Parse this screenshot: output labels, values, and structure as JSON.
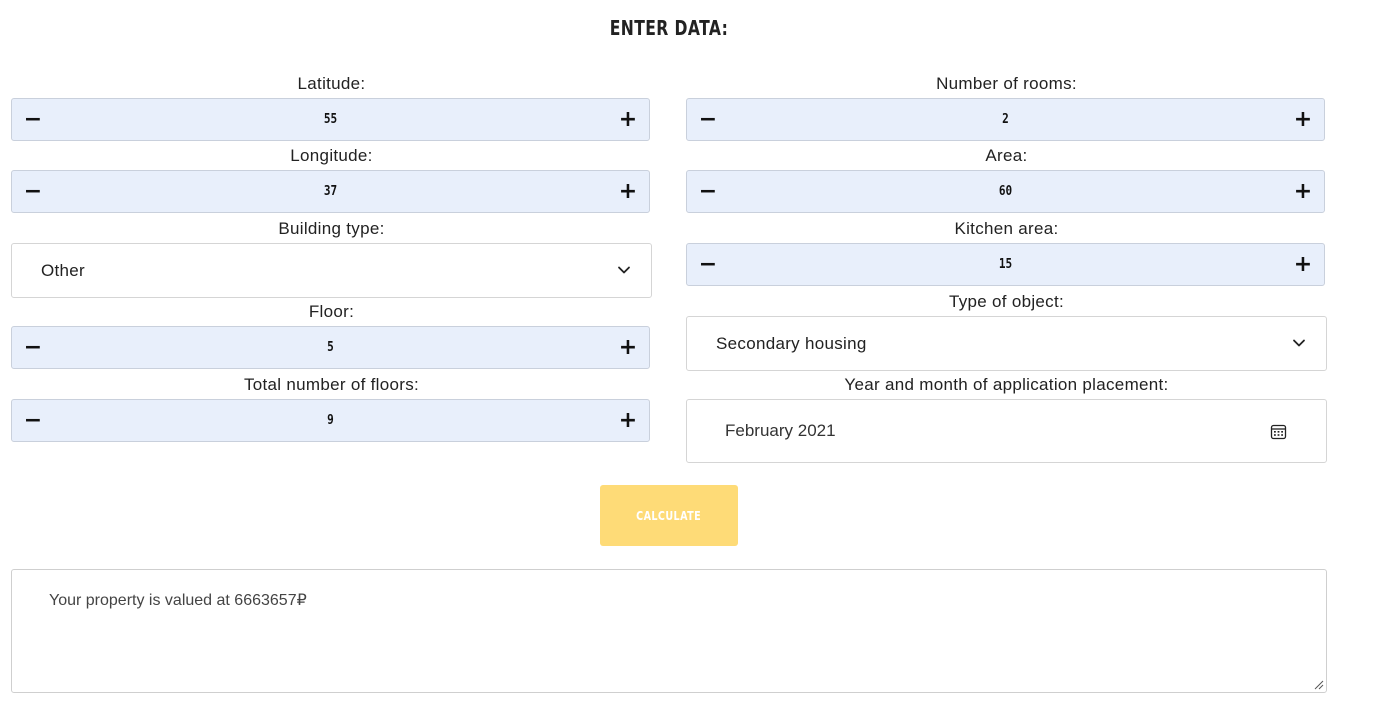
{
  "header": {
    "title": "ENTER DATA:"
  },
  "fields": {
    "latitude": {
      "label": "Latitude:",
      "value": "55",
      "minus": "−",
      "plus": "+"
    },
    "longitude": {
      "label": "Longitude:",
      "value": "37",
      "minus": "−",
      "plus": "+"
    },
    "building_type": {
      "label": "Building type:",
      "value": "Other"
    },
    "floor": {
      "label": "Floor:",
      "value": "5",
      "minus": "−",
      "plus": "+"
    },
    "total_floors": {
      "label": "Total number of floors:",
      "value": "9",
      "minus": "−",
      "plus": "+"
    },
    "rooms": {
      "label": "Number of rooms:",
      "value": "2",
      "minus": "−",
      "plus": "+"
    },
    "area": {
      "label": "Area:",
      "value": "60",
      "minus": "−",
      "plus": "+"
    },
    "kitchen_area": {
      "label": "Kitchen area:",
      "value": "15",
      "minus": "−",
      "plus": "+"
    },
    "object_type": {
      "label": "Type of object:",
      "value": "Secondary housing"
    },
    "placement_date": {
      "label": "Year and month of application placement:",
      "value": "February 2021"
    }
  },
  "actions": {
    "calculate_label": "CALCULATE"
  },
  "result": {
    "text": "Your property is valued at 6663657₽"
  },
  "colors": {
    "stepper_bg": "#e8effb",
    "button_accent": "#fedb77",
    "text": "#222222"
  },
  "icons": {
    "select_arrow": "chevron-down-icon",
    "date_picker": "calendar-icon",
    "resize": "resize-grip-icon"
  }
}
